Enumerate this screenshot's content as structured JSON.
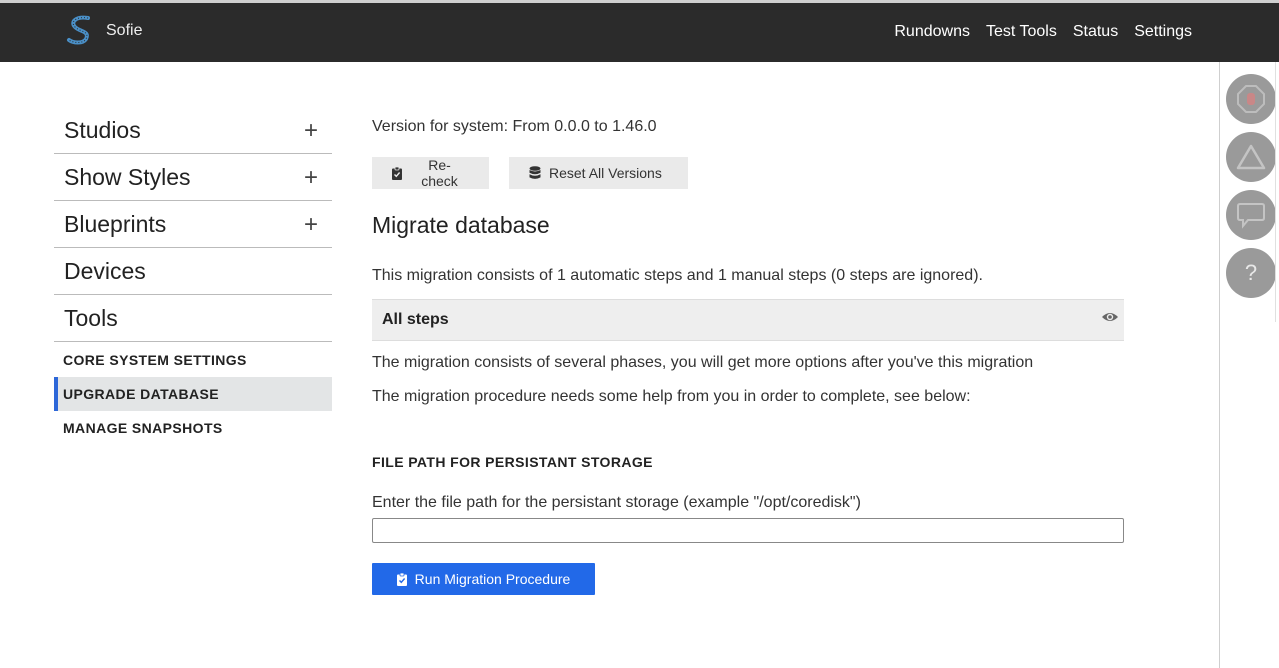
{
  "header": {
    "app_name": "Sofie",
    "nav": [
      "Rundowns",
      "Test Tools",
      "Status",
      "Settings"
    ]
  },
  "sidebar": {
    "items": [
      {
        "label": "Studios",
        "expandable": true
      },
      {
        "label": "Show Styles",
        "expandable": true
      },
      {
        "label": "Blueprints",
        "expandable": true
      },
      {
        "label": "Devices",
        "expandable": false
      },
      {
        "label": "Tools",
        "expandable": false
      }
    ],
    "subitems": [
      {
        "label": "CORE SYSTEM SETTINGS",
        "selected": false
      },
      {
        "label": "UPGRADE DATABASE",
        "selected": true
      },
      {
        "label": "MANAGE SNAPSHOTS",
        "selected": false
      }
    ]
  },
  "main": {
    "version_text": "Version for system: From 0.0.0 to 1.46.0",
    "recheck_label": "Re-check",
    "reset_label": "Reset All Versions",
    "section_title": "Migrate database",
    "migration_desc": "This migration consists of 1 automatic steps and 1 manual steps (0 steps are ignored).",
    "steps_label": "All steps",
    "info_phases": "The migration consists of several phases, you will get more options after you've this migration",
    "info_help": "The migration procedure needs some help from you in order to complete, see below:",
    "field_title": "FILE PATH FOR PERSISTANT STORAGE",
    "field_desc": "Enter the file path for the persistant storage (example \"/opt/coredisk\")",
    "field_value": "",
    "run_label": "Run Migration Procedure"
  },
  "rail": {
    "buttons": [
      "stop-icon",
      "warning-icon",
      "chat-icon",
      "help-icon"
    ],
    "help_glyph": "?"
  },
  "colors": {
    "header_bg": "#2b2b2b",
    "accent": "#2269e8",
    "selected_border": "#2d67d8",
    "rail_button": "#9a9a9a"
  }
}
